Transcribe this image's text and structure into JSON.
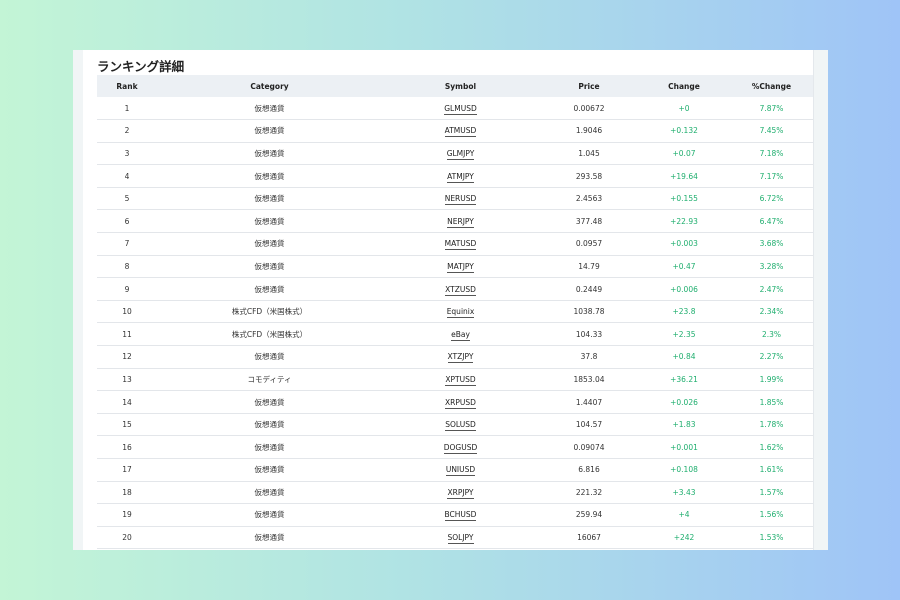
{
  "page": {
    "title": "ランキング詳細"
  },
  "table": {
    "headers": {
      "rank": "Rank",
      "category": "Category",
      "symbol": "Symbol",
      "price": "Price",
      "change": "Change",
      "pct": "%Change"
    },
    "rows": [
      {
        "rank": "1",
        "category": "仮想通貨",
        "symbol": "GLMUSD",
        "price": "0.00672",
        "change": "+0",
        "pct": "7.87%"
      },
      {
        "rank": "2",
        "category": "仮想通貨",
        "symbol": "ATMUSD",
        "price": "1.9046",
        "change": "+0.132",
        "pct": "7.45%"
      },
      {
        "rank": "3",
        "category": "仮想通貨",
        "symbol": "GLMJPY",
        "price": "1.045",
        "change": "+0.07",
        "pct": "7.18%"
      },
      {
        "rank": "4",
        "category": "仮想通貨",
        "symbol": "ATMJPY",
        "price": "293.58",
        "change": "+19.64",
        "pct": "7.17%"
      },
      {
        "rank": "5",
        "category": "仮想通貨",
        "symbol": "NERUSD",
        "price": "2.4563",
        "change": "+0.155",
        "pct": "6.72%"
      },
      {
        "rank": "6",
        "category": "仮想通貨",
        "symbol": "NERJPY",
        "price": "377.48",
        "change": "+22.93",
        "pct": "6.47%"
      },
      {
        "rank": "7",
        "category": "仮想通貨",
        "symbol": "MATUSD",
        "price": "0.0957",
        "change": "+0.003",
        "pct": "3.68%"
      },
      {
        "rank": "8",
        "category": "仮想通貨",
        "symbol": "MATJPY",
        "price": "14.79",
        "change": "+0.47",
        "pct": "3.28%"
      },
      {
        "rank": "9",
        "category": "仮想通貨",
        "symbol": "XTZUSD",
        "price": "0.2449",
        "change": "+0.006",
        "pct": "2.47%"
      },
      {
        "rank": "10",
        "category": "株式CFD（米国株式）",
        "symbol": "Equinix",
        "price": "1038.78",
        "change": "+23.8",
        "pct": "2.34%"
      },
      {
        "rank": "11",
        "category": "株式CFD（米国株式）",
        "symbol": "eBay",
        "price": "104.33",
        "change": "+2.35",
        "pct": "2.3%"
      },
      {
        "rank": "12",
        "category": "仮想通貨",
        "symbol": "XTZJPY",
        "price": "37.8",
        "change": "+0.84",
        "pct": "2.27%"
      },
      {
        "rank": "13",
        "category": "コモディティ",
        "symbol": "XPTUSD",
        "price": "1853.04",
        "change": "+36.21",
        "pct": "1.99%"
      },
      {
        "rank": "14",
        "category": "仮想通貨",
        "symbol": "XRPUSD",
        "price": "1.4407",
        "change": "+0.026",
        "pct": "1.85%"
      },
      {
        "rank": "15",
        "category": "仮想通貨",
        "symbol": "SOLUSD",
        "price": "104.57",
        "change": "+1.83",
        "pct": "1.78%"
      },
      {
        "rank": "16",
        "category": "仮想通貨",
        "symbol": "DOGUSD",
        "price": "0.09074",
        "change": "+0.001",
        "pct": "1.62%"
      },
      {
        "rank": "17",
        "category": "仮想通貨",
        "symbol": "UNIUSD",
        "price": "6.816",
        "change": "+0.108",
        "pct": "1.61%"
      },
      {
        "rank": "18",
        "category": "仮想通貨",
        "symbol": "XRPJPY",
        "price": "221.32",
        "change": "+3.43",
        "pct": "1.57%"
      },
      {
        "rank": "19",
        "category": "仮想通貨",
        "symbol": "BCHUSD",
        "price": "259.94",
        "change": "+4",
        "pct": "1.56%"
      },
      {
        "rank": "20",
        "category": "仮想通貨",
        "symbol": "SOLJPY",
        "price": "16067",
        "change": "+242",
        "pct": "1.53%"
      }
    ]
  },
  "colors": {
    "positive": "#1fae6e",
    "header_bg": "#ecf0f4"
  }
}
